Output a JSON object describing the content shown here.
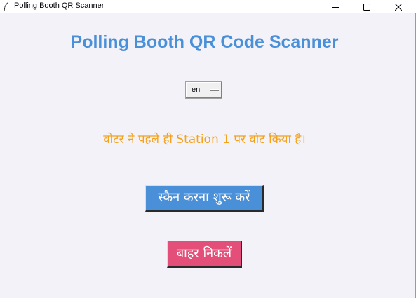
{
  "window": {
    "title": "Polling Booth QR Scanner",
    "icon": "feather-icon",
    "controls": [
      "minimize-icon",
      "maximize-icon",
      "close-icon"
    ]
  },
  "main": {
    "heading": "Polling Booth QR Code Scanner",
    "language_select": {
      "value": "en"
    },
    "status_message": "वोटर ने पहले ही Station 1 पर वोट किया है।",
    "start_button_label": "स्कैन करना शुरू करें",
    "exit_button_label": "बाहर निकलें"
  },
  "colors": {
    "heading": "#4a90d9",
    "status": "#f4a21a",
    "start_button": "#4a90d9",
    "exit_button": "#e44f79",
    "background": "#f3f2f8"
  }
}
